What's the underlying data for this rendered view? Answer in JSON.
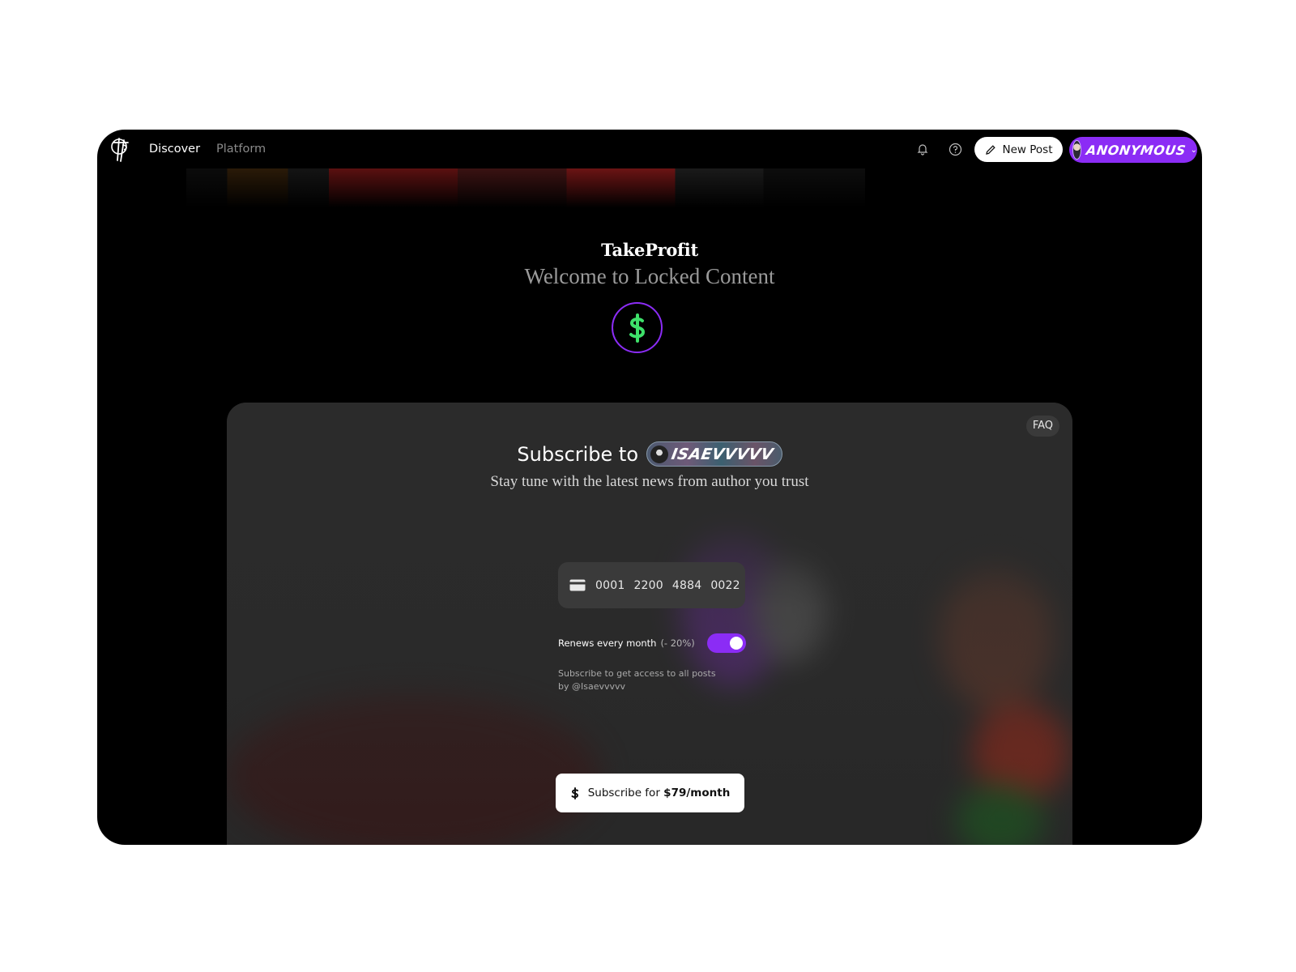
{
  "nav": {
    "links": [
      "Discover",
      "Platform"
    ],
    "new_post_label": "New Post",
    "user_name": "ANONYMOUS"
  },
  "hero": {
    "brand": "TakeProfit",
    "welcome": "Welcome to Locked Content"
  },
  "card": {
    "faq_label": "FAQ",
    "subscribe_prefix": "Subscribe to",
    "author_name": "ISAEVVVVV",
    "description": "Stay tune with the latest news from author you trust",
    "card_number_groups": [
      "0001",
      "2200",
      "4884",
      "0022"
    ],
    "renew_label": "Renews every month",
    "renew_discount": "(- 20%)",
    "renew_enabled": true,
    "access_text_line1": "Subscribe to get access to all posts",
    "access_text_line2": "by @Isaevvvvv",
    "subscribe_button_prefix": "Subscribe for",
    "subscribe_button_price": "$79/month"
  },
  "colors": {
    "accent": "#8b2cf5",
    "dollar_green": "#3ee06a",
    "window_bg": "#000000",
    "card_bg": "#2a2a2a"
  },
  "icons": [
    "logo-icon",
    "bell-icon",
    "help-icon",
    "pencil-icon",
    "chevron-down-icon",
    "dollar-icon",
    "credit-card-icon"
  ]
}
